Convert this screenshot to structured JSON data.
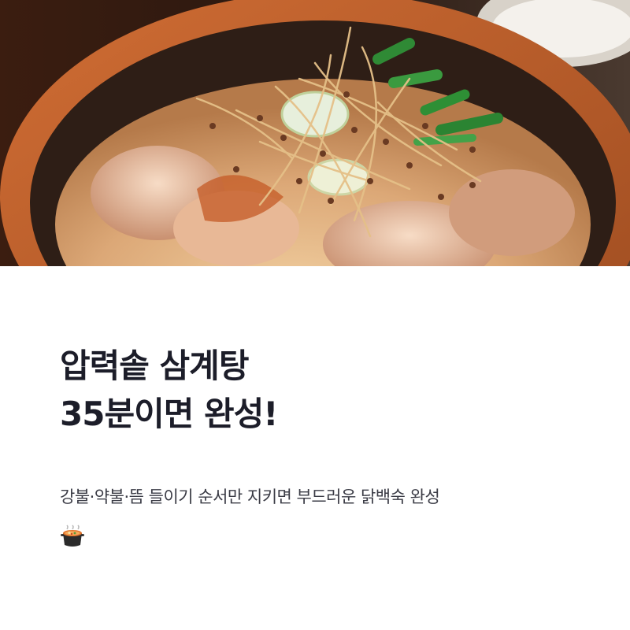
{
  "card": {
    "image_alt": "samgyetang-bowl-photo",
    "title_line1": "압력솥 삼계탕",
    "title_line2": "35분이면 완성!",
    "subtitle": "강불·약불·뜸 들이기 순서만 지키면 부드러운 닭백숙 완성",
    "emoji_icon": "stew-pot-icon"
  },
  "colors": {
    "title": "#1c1d29",
    "subtitle": "#3a3b45",
    "background": "#ffffff"
  }
}
